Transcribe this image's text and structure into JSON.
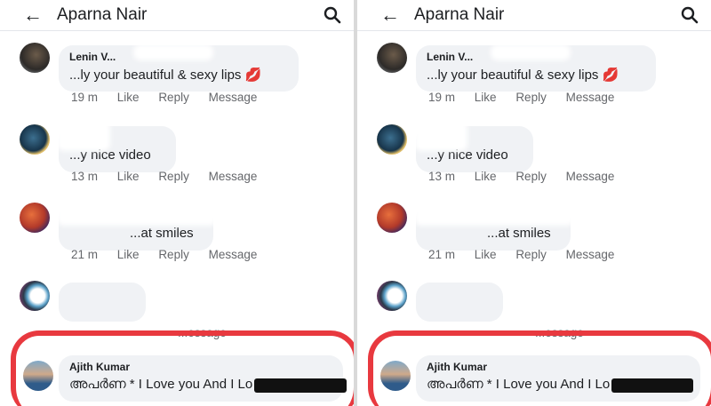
{
  "header": {
    "title": "Aparna Nair",
    "back_icon": "back-arrow-icon",
    "search_icon": "search-icon"
  },
  "comments": [
    {
      "name": "Lenin V...",
      "text": "...ly your beautiful & sexy lips 💋",
      "time": "19 m",
      "like": "Like",
      "reply": "Reply",
      "message": "Message"
    },
    {
      "name": "",
      "text": "...y nice video",
      "time": "13 m",
      "like": "Like",
      "reply": "Reply",
      "message": "Message"
    },
    {
      "name": "",
      "text": "...at smiles",
      "time": "21 m",
      "like": "Like",
      "reply": "Reply",
      "message": "Message"
    },
    {
      "name": "",
      "text": "",
      "time": "",
      "like": "",
      "reply": "",
      "message": "...essage"
    }
  ],
  "highlighted_comment": {
    "name": "Ajith Kumar",
    "text": "അപർണ * I Love you And I Lo"
  },
  "colors": {
    "highlight_ring": "#e8393f",
    "bubble": "#f0f2f5",
    "meta": "#65676b"
  }
}
